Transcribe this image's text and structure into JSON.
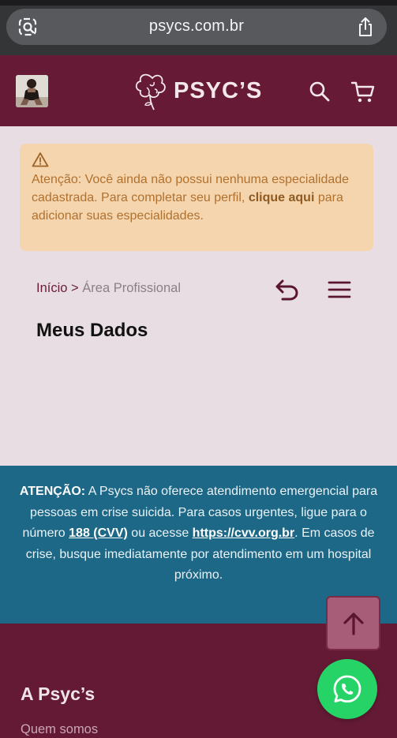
{
  "browser": {
    "url": "psycs.com.br"
  },
  "header": {
    "brand": "PSYC’S"
  },
  "alert": {
    "text_before": "Atenção: Você ainda não possui nenhuma especialidade cadastrada. Para completar seu perfil, ",
    "link_text": "clique aqui",
    "text_after": " para adicionar suas especialidades."
  },
  "breadcrumb": {
    "home": "Início",
    "separator": ">",
    "current": "Área Profissional"
  },
  "page": {
    "title": "Meus Dados"
  },
  "notice": {
    "label": "ATENÇÃO:",
    "text1": " A Psycs não oferece atendimento emergencial para pessoas em crise suicida. Para casos urgentes, ligue para o número ",
    "phone": "188 (CVV)",
    "text2": " ou acesse ",
    "site": "https://cvv.org.br",
    "text3": ". Em casos de crise, busque imediatamente por atendimento em um hospital próximo."
  },
  "footer": {
    "heading": "A Psyc’s",
    "link1": "Quem somos"
  },
  "icons": {
    "lens": "visual-lookup-icon",
    "share": "share-icon",
    "search": "search-icon",
    "cart": "cart-icon",
    "back": "back-icon",
    "menu": "hamburger-menu-icon",
    "warning": "warning-icon",
    "scroll_top": "arrow-up-icon",
    "whatsapp": "whatsapp-icon"
  },
  "colors": {
    "brand": "#671a35",
    "alert_bg": "#f5d5ae",
    "notice_bg": "#1d6887",
    "whatsapp": "#25d366"
  }
}
